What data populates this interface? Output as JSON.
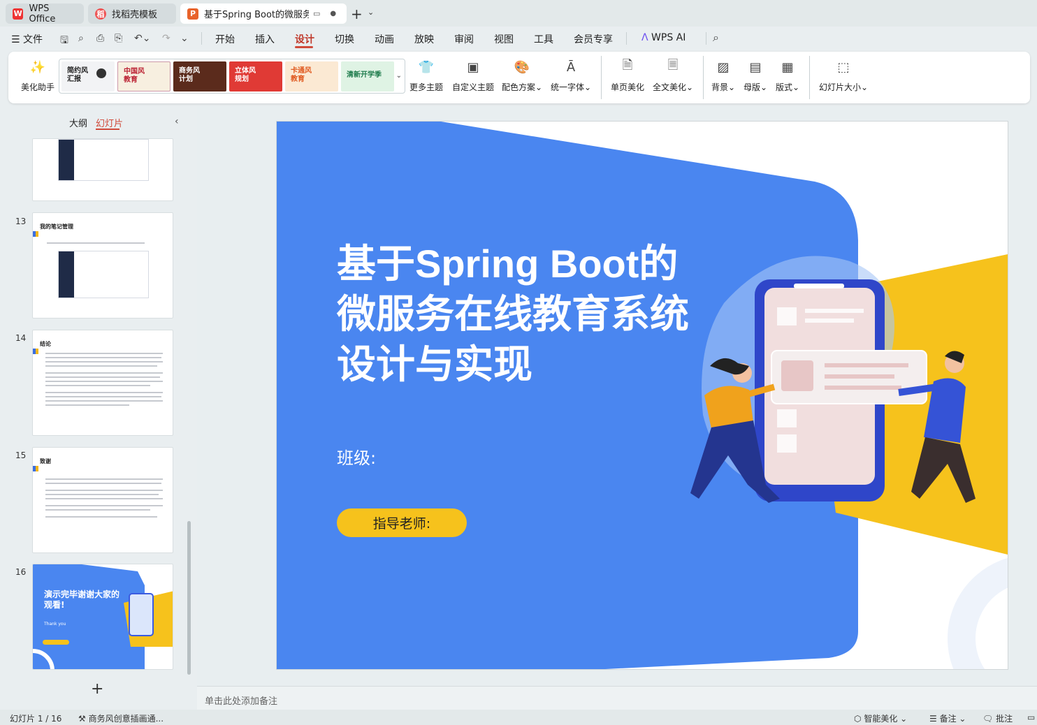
{
  "tabs": [
    {
      "label": "WPS Office"
    },
    {
      "label": "找稻壳模板"
    },
    {
      "label": "基于Spring Boot的微服务在线教育系统设计与实现"
    }
  ],
  "menu": {
    "file": "文件",
    "items": [
      "开始",
      "插入",
      "设计",
      "切换",
      "动画",
      "放映",
      "审阅",
      "视图",
      "工具",
      "会员专享"
    ],
    "active": "设计",
    "ai": "WPS AI"
  },
  "ribbon": {
    "beautify": "美化助手",
    "themes": [
      {
        "label": "简约风\n汇报"
      },
      {
        "label": "中国风\n教育"
      },
      {
        "label": "商务风\n计划"
      },
      {
        "label": "立体风\n规划"
      },
      {
        "label": "卡通风\n教育"
      },
      {
        "label": "清新开学季"
      }
    ],
    "buttons": [
      "更多主题",
      "自定义主题",
      "配色方案",
      "统一字体",
      "单页美化",
      "全文美化",
      "背景",
      "母版",
      "版式",
      "幻灯片大小"
    ]
  },
  "panel": {
    "tab_outline": "大纲",
    "tab_slides": "幻灯片",
    "slides": [
      {
        "num": "",
        "title": ""
      },
      {
        "num": "13",
        "title": "我的笔记管理"
      },
      {
        "num": "14",
        "title": "结论"
      },
      {
        "num": "15",
        "title": "致谢"
      },
      {
        "num": "16",
        "title": "演示完毕谢谢大家的观看!",
        "sub": "Thank you"
      }
    ]
  },
  "slide": {
    "title": "基于Spring Boot的微服务在线教育系统设计与实现",
    "class_label": "班级:",
    "advisor_label": "指导老师:"
  },
  "notes_placeholder": "单击此处添加备注",
  "status": {
    "slide_count": "幻灯片 1 / 16",
    "theme_name": "商务风创意插画通...",
    "smart": "智能美化",
    "notes": "备注",
    "comments": "批注"
  },
  "colors": {
    "accent": "#d04a3a",
    "slide_blue": "#4a86f0",
    "slide_yellow": "#f6c21c"
  }
}
